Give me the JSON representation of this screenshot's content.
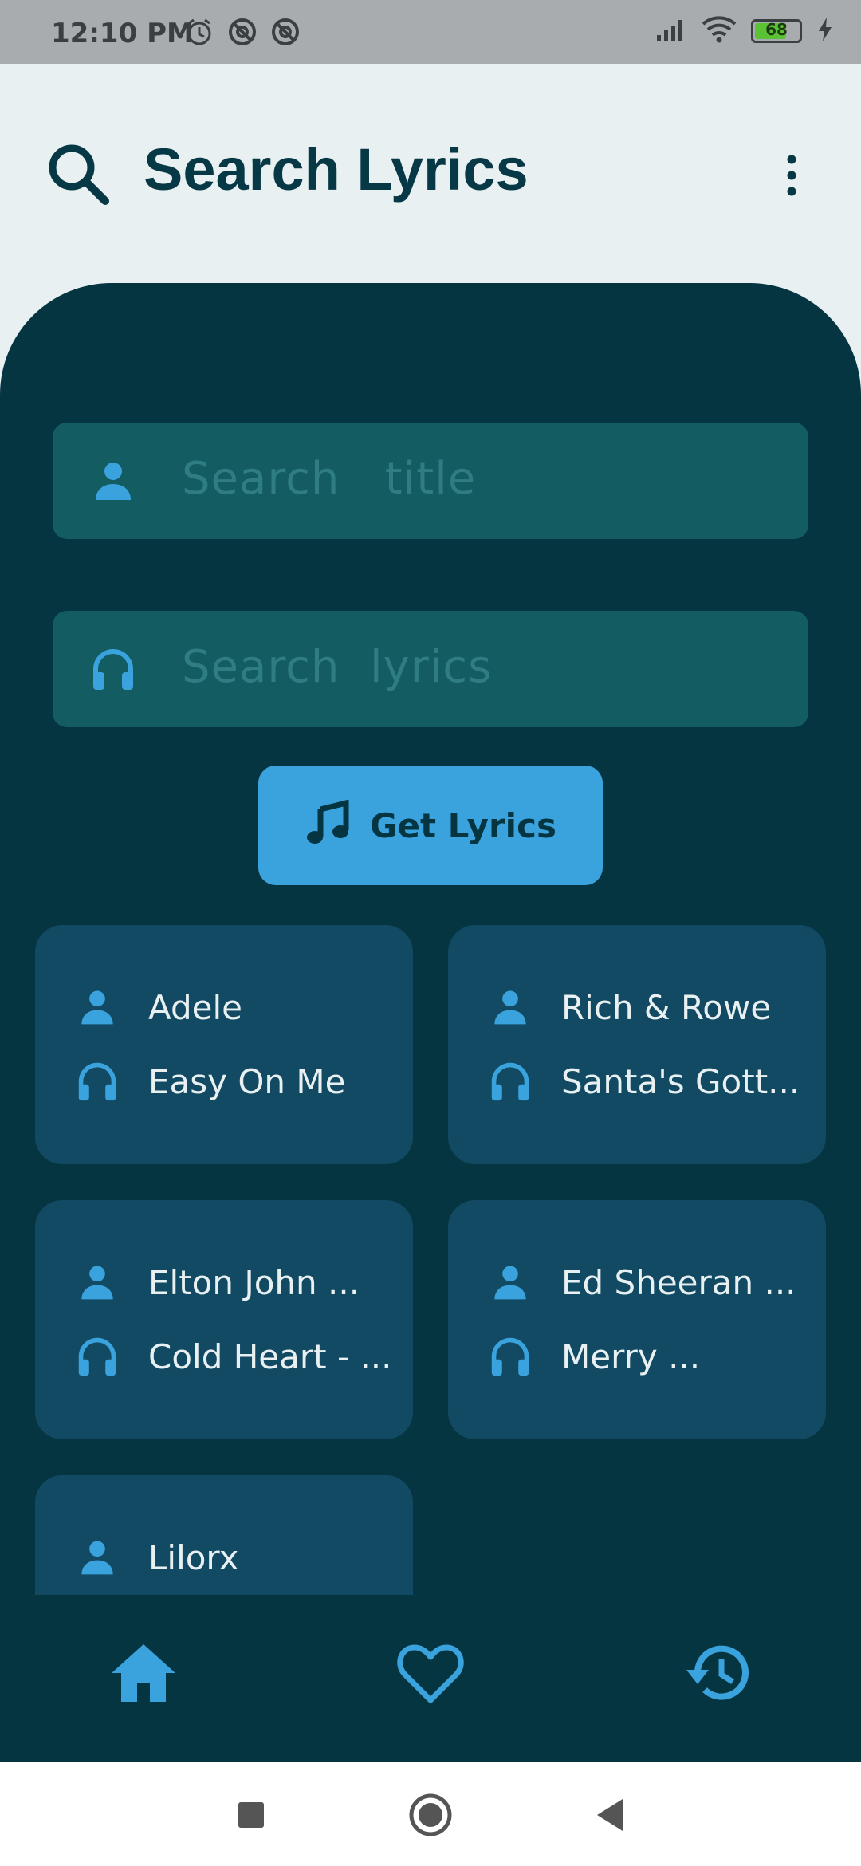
{
  "status_bar": {
    "time": "12:10 PM",
    "battery_level": "68",
    "icons": [
      "alarm-icon",
      "app-notification-icon",
      "app-notification-icon",
      "signal-icon",
      "wifi-icon",
      "battery-icon",
      "charging-icon"
    ]
  },
  "header": {
    "title": "Search Lyrics",
    "search_icon": "search-icon",
    "menu_icon": "more-vert-icon"
  },
  "search": {
    "title_placeholder": "Search   title",
    "lyrics_placeholder": "Search  lyrics",
    "button_label": "Get Lyrics"
  },
  "cards": [
    {
      "artist": "Adele",
      "song": "Easy On Me"
    },
    {
      "artist": "Rich & Rowe",
      "song": "Santa's Gott..."
    },
    {
      "artist": "Elton John ...",
      "song": "Cold Heart - ..."
    },
    {
      "artist": "Ed Sheeran ...",
      "song": "Merry ..."
    },
    {
      "artist": "Lilorx",
      "song": ""
    }
  ],
  "bottom_nav": {
    "items": [
      "home-icon",
      "favorite-icon",
      "history-icon"
    ],
    "active": "home"
  },
  "colors": {
    "background": "#e8f0f2",
    "panel": "#063542",
    "field": "#125c62",
    "card": "#124a63",
    "accent": "#3aa3de",
    "title": "#063845"
  }
}
